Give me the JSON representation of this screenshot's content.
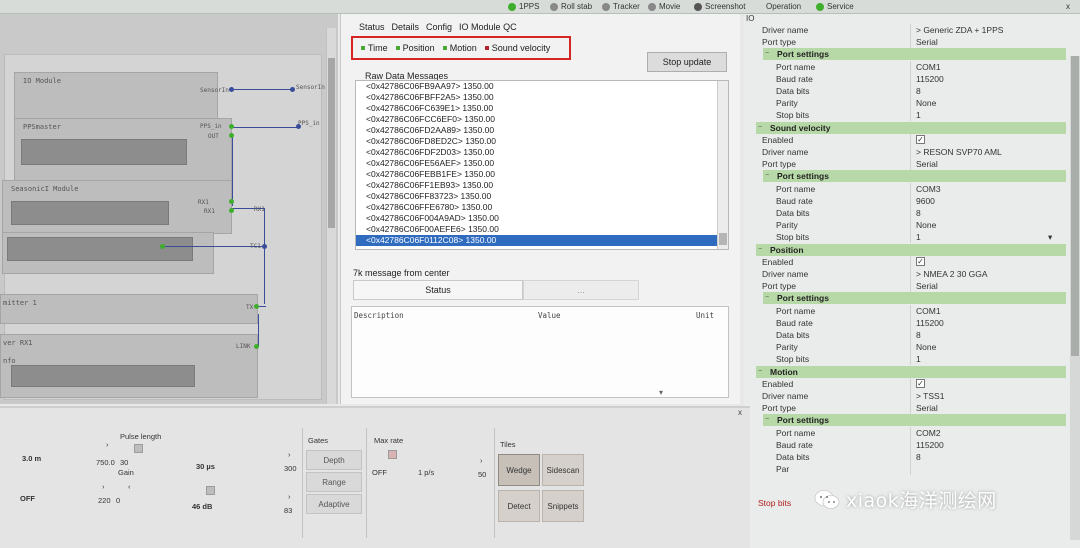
{
  "topbar": {
    "pps": "1PPS",
    "roll_stab": "Roll stab",
    "tracker": "Tracker",
    "movie": "Movie",
    "screenshot": "Screenshot",
    "operation": "Operation",
    "service": "Service",
    "close": "x"
  },
  "left": {
    "modules": {
      "io_module": "IO Module",
      "ppsmaster": "PPSmaster",
      "seasonic_module": "SeasonicI Module",
      "transmitter": "mitter 1",
      "receiver": "ver RX1",
      "info": "nfo"
    },
    "ports": {
      "sensorin_out": "SensorIn",
      "sensorin_in": "SensorIn",
      "pps_in_a": "PPS_in",
      "pps_in_b": "PPS_in",
      "out": "OUT",
      "rx1": "RX1",
      "rx1_b": "RX1",
      "tc1": "TC1",
      "tx": "TX",
      "link": "LINK"
    }
  },
  "center": {
    "menu": [
      "Status",
      "Details",
      "Config",
      "IO Module QC"
    ],
    "legend": [
      {
        "label": "Time",
        "color": "#4aa836"
      },
      {
        "label": "Position",
        "color": "#4aa836"
      },
      {
        "label": "Motion",
        "color": "#4aa836"
      },
      {
        "label": "Sound velocity",
        "color": "#b0232f"
      }
    ],
    "stop_update": "Stop update",
    "raw_title": "Raw Data Messages",
    "raw_rows": [
      "<0x42786C06FB9AA97> 1350.00",
      "<0x42786C06FBFF2A5> 1350.00",
      "<0x42786C06FC639E1> 1350.00",
      "<0x42786C06FCC6EF0> 1350.00",
      "<0x42786C06FD2AA89> 1350.00",
      "<0x42786C06FD8ED2C> 1350.00",
      "<0x42786C06FDF2D03> 1350.00",
      "<0x42786C06FE56AEF> 1350.00",
      "<0x42786C06FEBB1FE> 1350.00",
      "<0x42786C06FF1EB93> 1350.00",
      "<0x42786C06FF83723> 1350.00",
      "<0x42786C06FFE6780> 1350.00",
      "<0x42786C06F004A9AD> 1350.00",
      "<0x42786C06F00AEFE6> 1350.00",
      "<0x42786C06F0112C08> 1350.00"
    ],
    "k7_title": "7k message from center",
    "tab_status": "Status",
    "tab_other": "...",
    "table_headers": [
      "Description",
      "Value",
      "Unit"
    ]
  },
  "right": {
    "io_label": "IO",
    "rows": [
      {
        "type": "kv",
        "key": "Driver name",
        "value": "> Generic ZDA + 1PPS",
        "indent": 0
      },
      {
        "type": "kv",
        "key": "Port type",
        "value": "Serial",
        "indent": 0
      },
      {
        "type": "sec",
        "title": "Port settings",
        "indent": 1
      },
      {
        "type": "kv",
        "key": "Port name",
        "value": "COM1",
        "indent": 2
      },
      {
        "type": "kv",
        "key": "Baud rate",
        "value": "115200",
        "indent": 2
      },
      {
        "type": "kv",
        "key": "Data bits",
        "value": "8",
        "indent": 2
      },
      {
        "type": "kv",
        "key": "Parity",
        "value": "None",
        "indent": 2
      },
      {
        "type": "kv",
        "key": "Stop bits",
        "value": "1",
        "indent": 2
      },
      {
        "type": "sec",
        "title": "Sound velocity",
        "indent": 0
      },
      {
        "type": "chk",
        "key": "Enabled",
        "value": "✓",
        "indent": 0
      },
      {
        "type": "kv",
        "key": "Driver name",
        "value": "> RESON SVP70 AML",
        "indent": 0
      },
      {
        "type": "kv",
        "key": "Port type",
        "value": "Serial",
        "indent": 0
      },
      {
        "type": "sec",
        "title": "Port settings",
        "indent": 1
      },
      {
        "type": "kv",
        "key": "Port name",
        "value": "COM3",
        "indent": 2
      },
      {
        "type": "kv",
        "key": "Baud rate",
        "value": "9600",
        "indent": 2
      },
      {
        "type": "kv",
        "key": "Data bits",
        "value": "8",
        "indent": 2
      },
      {
        "type": "kv",
        "key": "Parity",
        "value": "None",
        "indent": 2
      },
      {
        "type": "kv",
        "key": "Stop bits",
        "value": "1",
        "indent": 2,
        "dropdown": true
      },
      {
        "type": "sec",
        "title": "Position",
        "indent": 0
      },
      {
        "type": "chk",
        "key": "Enabled",
        "value": "✓",
        "indent": 0
      },
      {
        "type": "kv",
        "key": "Driver name",
        "value": "> NMEA 2 30 GGA",
        "indent": 0
      },
      {
        "type": "kv",
        "key": "Port type",
        "value": "Serial",
        "indent": 0
      },
      {
        "type": "sec",
        "title": "Port settings",
        "indent": 1
      },
      {
        "type": "kv",
        "key": "Port name",
        "value": "COM1",
        "indent": 2
      },
      {
        "type": "kv",
        "key": "Baud rate",
        "value": "115200",
        "indent": 2
      },
      {
        "type": "kv",
        "key": "Data bits",
        "value": "8",
        "indent": 2
      },
      {
        "type": "kv",
        "key": "Parity",
        "value": "None",
        "indent": 2
      },
      {
        "type": "kv",
        "key": "Stop bits",
        "value": "1",
        "indent": 2
      },
      {
        "type": "sec",
        "title": "Motion",
        "indent": 0
      },
      {
        "type": "chk",
        "key": "Enabled",
        "value": "✓",
        "indent": 0
      },
      {
        "type": "kv",
        "key": "Driver name",
        "value": "> TSS1",
        "indent": 0
      },
      {
        "type": "kv",
        "key": "Port type",
        "value": "Serial",
        "indent": 0
      },
      {
        "type": "sec",
        "title": "Port settings",
        "indent": 1
      },
      {
        "type": "kv",
        "key": "Port name",
        "value": "COM2",
        "indent": 2
      },
      {
        "type": "kv",
        "key": "Baud rate",
        "value": "115200",
        "indent": 2
      },
      {
        "type": "kv",
        "key": "Data bits",
        "value": "8",
        "indent": 2
      },
      {
        "type": "kv",
        "key": "Par",
        "value": "",
        "indent": 2
      }
    ],
    "stop_bits_bottom": "Stop bits"
  },
  "bottom": {
    "close": "x",
    "range_val": "3.0 m",
    "off": "OFF",
    "pulse_length": "Pulse length",
    "val_750": "750.0",
    "val_30": "30",
    "gain": "Gain",
    "val_220": "220",
    "val_0": "0",
    "pulse_30us": "30 µs",
    "gain_46": "46 dB",
    "val_300": "300",
    "val_83": "83",
    "gates": "Gates",
    "depth": "Depth",
    "range": "Range",
    "adaptive": "Adaptive",
    "max_rate": "Max rate",
    "off2": "OFF",
    "rate": "1 p/s",
    "val_50": "50",
    "tiles": "Tiles",
    "wedge": "Wedge",
    "sidescan": "Sidescan",
    "detect": "Detect",
    "snippets": "Snippets"
  },
  "watermark": {
    "text": "xiaok海洋测绘网"
  },
  "colors": {
    "selection": "#2f6cc0",
    "section_green": "#b7d8a7",
    "highlight_red": "#d52424",
    "wire_blue": "#3a4d9a",
    "port_green": "#3fae2c"
  }
}
